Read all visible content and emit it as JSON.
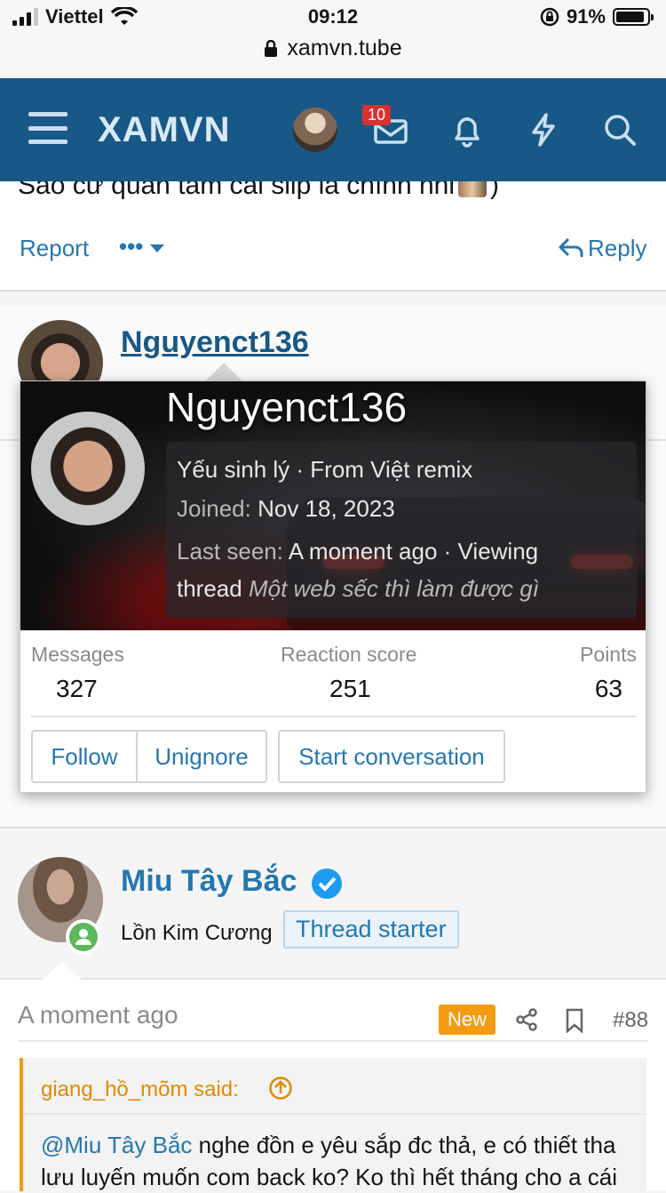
{
  "statusbar": {
    "carrier": "Viettel",
    "time": "09:12",
    "battery": "91%",
    "url": "xamvn.tube"
  },
  "header": {
    "logo": "XAMVN",
    "badge_count": "10"
  },
  "prev_post": {
    "text": "Sao cứ quan tâm cái slip là chính nhỉ",
    "report": "Report",
    "reply": "Reply"
  },
  "post1": {
    "username": "Nguyenct136"
  },
  "popup": {
    "username": "Nguyenct136",
    "title_line": "Yếu sinh lý · From Việt remix",
    "joined_label": "Joined:",
    "joined_value": "Nov 18, 2023",
    "last_seen_label": "Last seen:",
    "last_seen_value": "A moment ago · Viewing",
    "thread_label": "thread",
    "thread_name": "Một web sếc thì làm được gì",
    "stats": {
      "messages_label": "Messages",
      "messages_value": "327",
      "reaction_label": "Reaction score",
      "reaction_value": "251",
      "points_label": "Points",
      "points_value": "63"
    },
    "buttons": {
      "follow": "Follow",
      "unignore": "Unignore",
      "start_conversation": "Start conversation"
    }
  },
  "post2": {
    "username": "Miu Tây Bắc",
    "user_title": "Lồn Kim Cương",
    "thread_starter": "Thread starter",
    "time": "A moment ago",
    "new_badge": "New",
    "post_number": "#88",
    "quote_author": "giang_hồ_mõm said:",
    "quote_mention": "@Miu Tây Bắc",
    "quote_text_1": " nghe đồn e yêu sắp đc thả, e có thiết tha",
    "quote_text_2": "lưu luyến muốn com back ko? Ko thì hết tháng cho a cái"
  },
  "colors": {
    "header_bg": "#185886",
    "link": "#2577b1",
    "new_badge": "#f39c12",
    "online": "#5cb85c"
  }
}
